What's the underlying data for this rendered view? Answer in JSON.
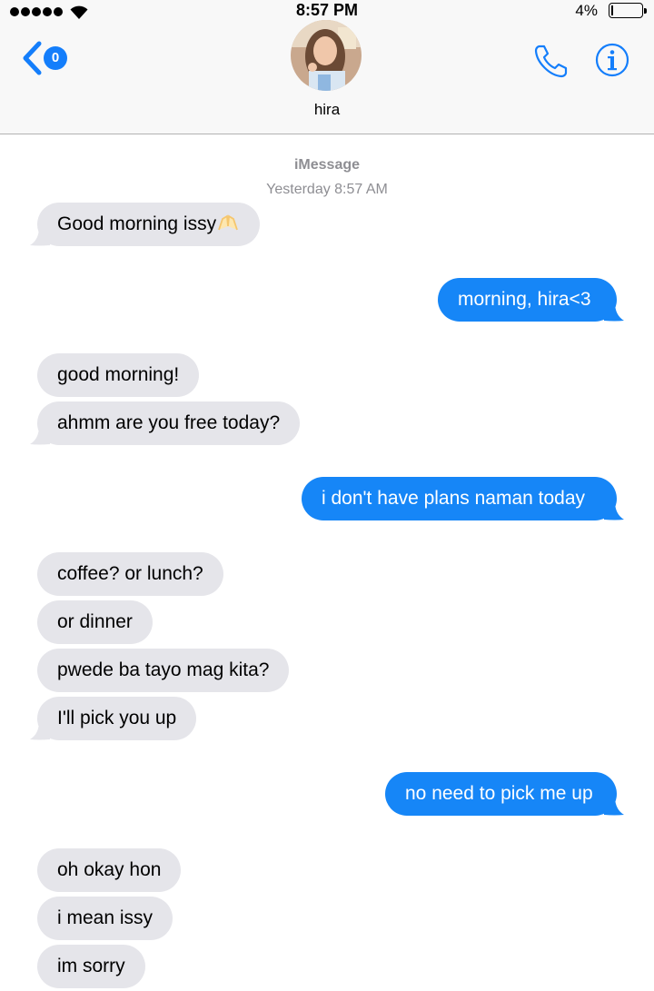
{
  "status_bar": {
    "time": "8:57 PM",
    "battery": "4%",
    "battery_level": 0.04
  },
  "header": {
    "back_badge": "0",
    "contact_name": "hira"
  },
  "conversation": {
    "service": "iMessage",
    "timestamp": "Yesterday 8:57 AM",
    "messages": [
      {
        "from": "them",
        "text": "Good morning issy",
        "emoji": "folded-hands-emoji"
      },
      {
        "from": "me",
        "text": "morning, hira<3"
      },
      {
        "from": "them",
        "text": "good morning!"
      },
      {
        "from": "them",
        "text": "ahmm are you free today?"
      },
      {
        "from": "me",
        "text": "i don't have plans naman today"
      },
      {
        "from": "them",
        "text": "coffee? or lunch?"
      },
      {
        "from": "them",
        "text": "or dinner"
      },
      {
        "from": "them",
        "text": "pwede ba tayo mag kita?"
      },
      {
        "from": "them",
        "text": "I'll pick you up"
      },
      {
        "from": "me",
        "text": "no need to pick me up"
      },
      {
        "from": "them",
        "text": "oh okay hon"
      },
      {
        "from": "them",
        "text": "i mean issy"
      },
      {
        "from": "them",
        "text": "im sorry"
      }
    ]
  },
  "colors": {
    "accent": "#147efb",
    "outgoing_bubble": "#1686f7",
    "incoming_bubble": "#e5e5ea",
    "meta_text": "#8e8e93"
  }
}
